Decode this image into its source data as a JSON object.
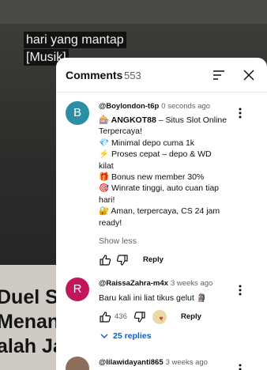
{
  "video": {
    "caption_lines": [
      "hari yang mantap",
      "[Musik]"
    ],
    "headline_lines": [
      "Duel S",
      "Menang",
      "alah Ja"
    ]
  },
  "panel": {
    "title": "Comments",
    "count": "553"
  },
  "comments": [
    {
      "initial": "B",
      "avatar_color": "#2a8fa4",
      "author": "@Boylondon-t6p",
      "time": "0 seconds ago",
      "lines": [
        {
          "icon": "🎰",
          "bold": "ANGKOT88",
          "text": " – Situs Slot Online"
        },
        {
          "icon": "",
          "bold": "",
          "text": "Terpercaya!"
        },
        {
          "icon": "💎",
          "bold": "",
          "text": " Minimal depo cuma 1k"
        },
        {
          "icon": "⚡",
          "bold": "",
          "text": " Proses cepat – depo & WD"
        },
        {
          "icon": "",
          "bold": "",
          "text": "kilat"
        },
        {
          "icon": "🎁",
          "bold": "",
          "text": " Bonus new member 30%"
        },
        {
          "icon": "🎯",
          "bold": "",
          "text": " Winrate tinggi, auto cuan tiap"
        },
        {
          "icon": "",
          "bold": "",
          "text": "hari!"
        },
        {
          "icon": "🔐",
          "bold": "",
          "text": " Aman, terpercaya, CS 24 jam"
        },
        {
          "icon": "",
          "bold": "",
          "text": "ready!"
        }
      ],
      "show_less": "Show less",
      "like_count": "",
      "reply_label": "Reply"
    },
    {
      "initial": "R",
      "avatar_color": "#c2185b",
      "author": "@RaissaZahra-m4x",
      "time": "3 weeks ago",
      "text": "Baru kali ini liat tikus gelut 🗿",
      "like_count": "436",
      "reply_label": "Reply",
      "replies": "25 replies"
    },
    {
      "author": "@lilawidayanti865",
      "time": "3 weeks ago",
      "avatar_color": "#8c6f5c"
    }
  ]
}
